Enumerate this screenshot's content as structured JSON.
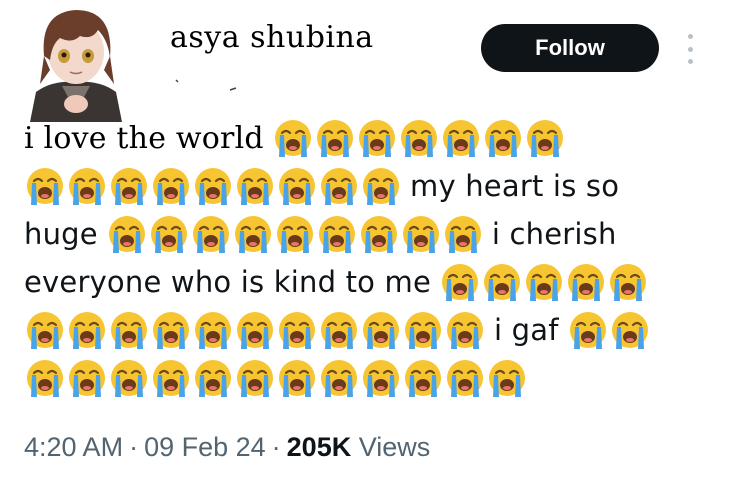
{
  "author": {
    "display_name": "asya shubina",
    "follow_label": "Follow"
  },
  "tweet": {
    "segments": [
      [
        {
          "text": "i love the world",
          "style": "serif"
        },
        {
          "emoji": 7
        }
      ],
      [
        {
          "emoji": 9
        },
        {
          "text": "my heart is so"
        }
      ],
      [
        {
          "text": "huge"
        },
        {
          "emoji": 9
        },
        {
          "text": "i cherish"
        }
      ],
      [
        {
          "text": "everyone who is kind to me"
        },
        {
          "emoji": 5
        }
      ],
      [
        {
          "emoji": 11
        },
        {
          "text": "i gaf"
        },
        {
          "emoji": 2
        }
      ],
      [
        {
          "emoji": 12
        }
      ]
    ],
    "emoji_name": "loudly-crying-face-icon"
  },
  "meta": {
    "time": "4:20 AM",
    "date": "09 Feb 24",
    "views_count": "205K",
    "views_label": "Views"
  },
  "colors": {
    "follow_bg": "#0f1419",
    "meta_text": "#536471",
    "emoji_face": "#f7c531",
    "emoji_tears": "#4aa3e8"
  }
}
